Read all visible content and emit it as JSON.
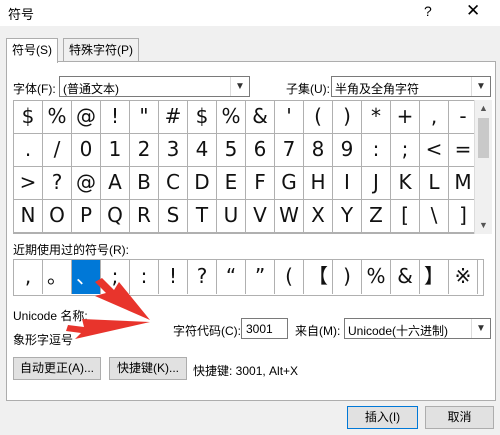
{
  "window": {
    "title": "符号",
    "help_glyph": "?",
    "close_glyph": "✕"
  },
  "tabs": [
    {
      "label": "符号(S)"
    },
    {
      "label": "特殊字符(P)"
    }
  ],
  "font": {
    "label": "字体(F):",
    "value": "(普通文本)"
  },
  "subset": {
    "label": "子集(U):",
    "value": "半角及全角字符"
  },
  "grid": {
    "rows": [
      [
        "$",
        "%",
        "@",
        "!",
        "\"",
        "#",
        "$",
        "%",
        "&",
        "'",
        "(",
        ")",
        "*",
        "+",
        ",",
        "-"
      ],
      [
        ".",
        "/",
        "0",
        "1",
        "2",
        "3",
        "4",
        "5",
        "6",
        "7",
        "8",
        "9",
        ":",
        ";",
        "<",
        "="
      ],
      [
        ">",
        "?",
        "@",
        "A",
        "B",
        "C",
        "D",
        "E",
        "F",
        "G",
        "H",
        "I",
        "J",
        "K",
        "L",
        "M"
      ],
      [
        "N",
        "O",
        "P",
        "Q",
        "R",
        "S",
        "T",
        "U",
        "V",
        "W",
        "X",
        "Y",
        "Z",
        "[",
        "\\",
        "]"
      ]
    ]
  },
  "recent": {
    "label": "近期使用过的符号(R):",
    "items": [
      ",",
      "。",
      "、",
      ";",
      ":",
      "!",
      "?",
      "“",
      "”",
      "(",
      "【",
      ")",
      "%",
      "&",
      "】",
      "※"
    ],
    "selected_index": 2
  },
  "unicode_name": {
    "label": "Unicode 名称:",
    "value": "象形字逗号"
  },
  "char_code": {
    "label": "字符代码(C):",
    "value": "3001"
  },
  "from": {
    "label": "来自(M):",
    "value": "Unicode(十六进制)"
  },
  "buttons": {
    "autocorrect": "自动更正(A)...",
    "shortcut": "快捷键(K)...",
    "insert": "插入(I)",
    "cancel": "取消"
  },
  "shortcut_info": "快捷键: 3001, Alt+X",
  "icons": {
    "dropdown": "chevron-down-icon",
    "scroll_up": "scroll-up-icon",
    "scroll_down": "scroll-down-icon"
  },
  "colors": {
    "selection": "#0078d7",
    "annotation_arrow": "#e8342c"
  }
}
